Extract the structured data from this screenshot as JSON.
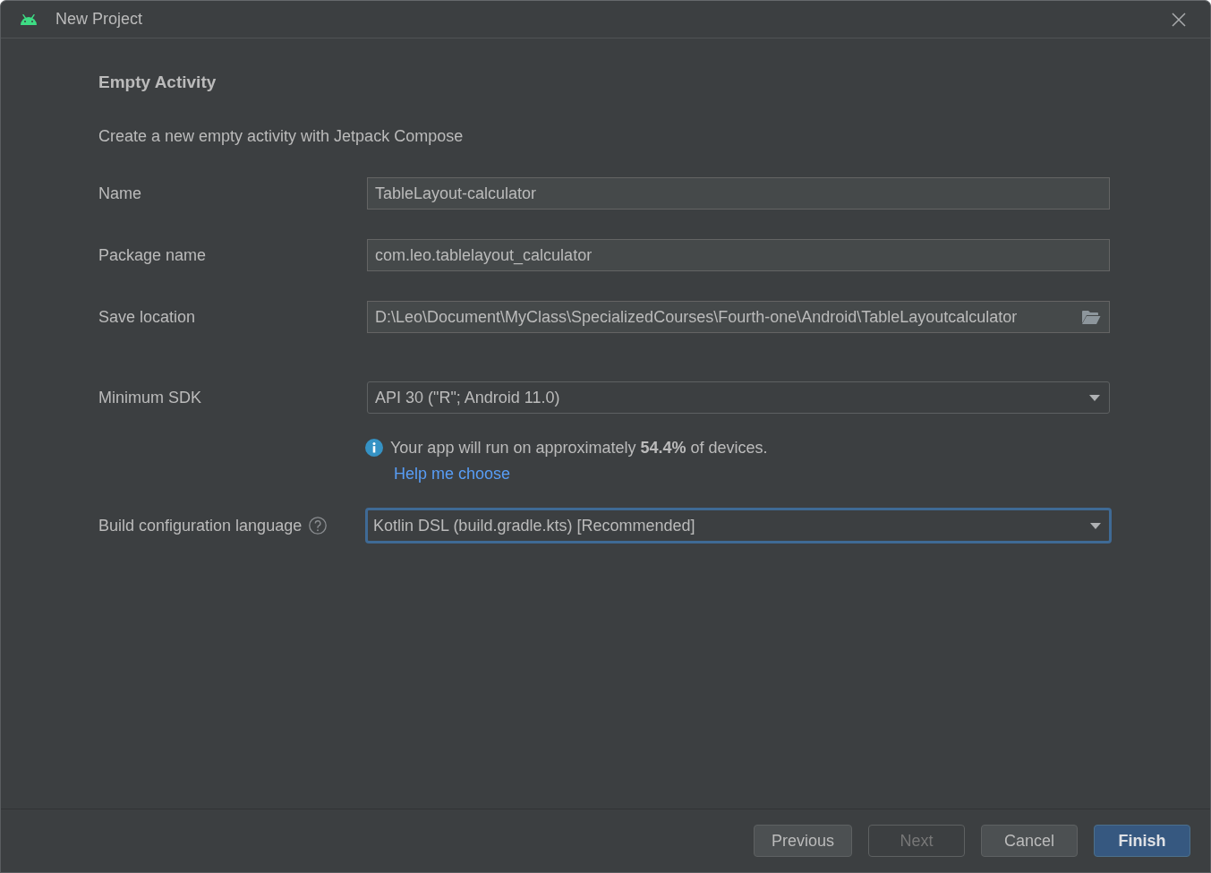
{
  "window": {
    "title": "New Project"
  },
  "template": {
    "title": "Empty Activity",
    "description": "Create a new empty activity with Jetpack Compose"
  },
  "fields": [
    {
      "kind": "text",
      "label": "Name",
      "value": "TableLayout-calculator",
      "help": false,
      "focused": false
    },
    {
      "kind": "text",
      "label": "Package name",
      "value": "com.leo.tablelayout_calculator",
      "help": false,
      "focused": false
    },
    {
      "kind": "folder",
      "label": "Save location",
      "value": "D:\\Leo\\Document\\MyClass\\SpecializedCourses\\Fourth-one\\Android\\TableLayoutcalculator",
      "help": false,
      "focused": false
    },
    {
      "kind": "dropdown",
      "label": "Minimum SDK",
      "value": "API 30 (\"R\"; Android 11.0)",
      "help": false,
      "focused": false,
      "note": {
        "text": "Your app will run on approximately **54.4%** of devices.",
        "link": "Help me choose"
      }
    },
    {
      "kind": "dropdown",
      "label": "Build configuration language",
      "value": "Kotlin DSL (build.gradle.kts) [Recommended]",
      "help": true,
      "focused": true
    }
  ],
  "buttons": [
    {
      "label": "Previous",
      "disabled": false,
      "primary": false
    },
    {
      "label": "Next",
      "disabled": true,
      "primary": false
    },
    {
      "label": "Cancel",
      "disabled": false,
      "primary": false
    },
    {
      "label": "Finish",
      "disabled": false,
      "primary": true
    }
  ]
}
